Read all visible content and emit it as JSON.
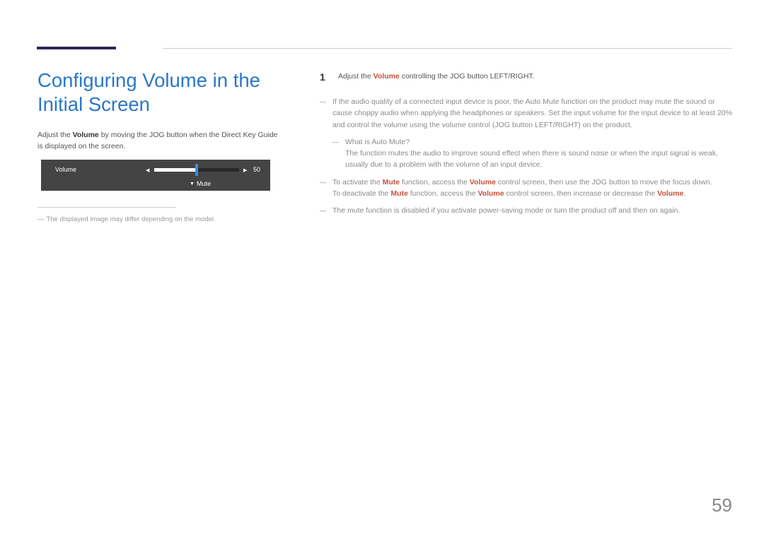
{
  "title": "Configuring Volume in the Initial Screen",
  "left": {
    "intro_pre": "Adjust the ",
    "intro_b": "Volume",
    "intro_post": " by moving the JOG button when the Direct Key Guide is displayed on the screen."
  },
  "osd": {
    "label": "Volume",
    "value": "50",
    "mute": "Mute",
    "left_tri": "◀",
    "right_tri": "▶",
    "down_tri": "▼"
  },
  "footnote": {
    "dash": "―",
    "text": "The displayed image may differ depending on the model."
  },
  "step": {
    "num": "1",
    "t1": "Adjust the ",
    "hl": "Volume",
    "t2": " controlling the JOG button LEFT/RIGHT."
  },
  "notes": {
    "n1": "If the audio quality of a connected input device is poor, the Auto Mute function on the product may mute the sound or cause choppy audio when applying the headphones or speakers. Set the input volume for the input device to at least 20% and control the volume using the volume control (JOG button LEFT/RIGHT) on the product.",
    "n1a_q": "What is Auto Mute?",
    "n1a_a": "The function mutes the audio to improve sound effect when there is sound noise or when the input signal is weak, usually due to a problem with the volume of an input device.",
    "n2_t1": "To activate the ",
    "n2_hl1": "Mute",
    "n2_t2": " function, access the ",
    "n2_hl2": "Volume",
    "n2_t3": " control screen, then use the JOG button to move the focus down.",
    "n2b_t1": "To deactivate the ",
    "n2b_hl1": "Mute",
    "n2b_t2": " function, access the ",
    "n2b_hl2": "Volume",
    "n2b_t3": " control screen, then increase or decrease the ",
    "n2b_hl3": "Volume",
    "n2b_t4": ".",
    "n3": "The mute function is disabled if you activate power-saving mode or turn the product off and then on again."
  },
  "page": "59"
}
